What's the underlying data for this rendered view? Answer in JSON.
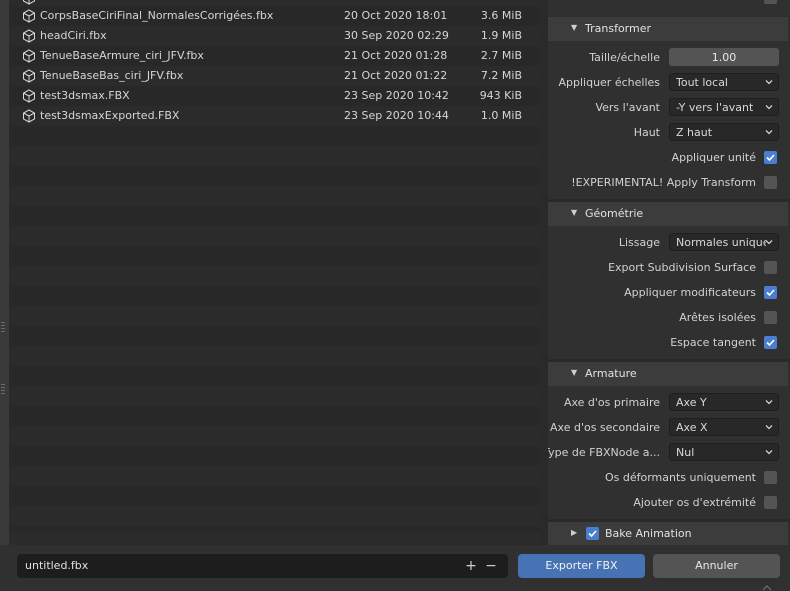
{
  "files": [
    {
      "name": "CorpsBaseCiriFinal_NormalesCorrigées.fbx",
      "date": "20 Oct 2020 18:01",
      "size": "3.6 MiB"
    },
    {
      "name": "headCiri.fbx",
      "date": "30 Sep 2020 02:29",
      "size": "1.9 MiB"
    },
    {
      "name": "TenueBaseArmure_ciri_JFV.fbx",
      "date": "21 Oct 2020 01:28",
      "size": "2.7 MiB"
    },
    {
      "name": "TenueBaseBas_ciri_JFV.fbx",
      "date": "21 Oct 2020 01:22",
      "size": "7.2 MiB"
    },
    {
      "name": "test3dsmax.FBX",
      "date": "23 Sep 2020 10:42",
      "size": "943 KiB"
    },
    {
      "name": "test3dsmaxExported.FBX",
      "date": "23 Sep 2020 10:44",
      "size": "1.0 MiB"
    }
  ],
  "transformer": {
    "title": "Transformer",
    "scale_label": "Taille/échelle",
    "scale_value": "1.00",
    "apply_scalings_label": "Appliquer échelles",
    "apply_scalings_value": "Tout local",
    "forward_label": "Vers l'avant",
    "forward_value": "-Y vers l'avant",
    "up_label": "Haut",
    "up_value": "Z haut",
    "apply_unit_label": "Appliquer unité",
    "apply_unit_checked": true,
    "apply_transform_label": "!EXPERIMENTAL! Apply Transform",
    "apply_transform_checked": false
  },
  "geometry": {
    "title": "Géométrie",
    "smoothing_label": "Lissage",
    "smoothing_value": "Normales unique...",
    "subdiv_label": "Export Subdivision Surface",
    "subdiv_checked": false,
    "modifiers_label": "Appliquer modificateurs",
    "modifiers_checked": true,
    "loose_label": "Arêtes isolées",
    "loose_checked": false,
    "tangent_label": "Espace tangent",
    "tangent_checked": true
  },
  "armature": {
    "title": "Armature",
    "primary_label": "Axe d'os primaire",
    "primary_value": "Axe Y",
    "secondary_label": "Axe d'os secondaire",
    "secondary_value": "Axe X",
    "node_type_label": "Type de FBXNode a...",
    "node_type_value": "Nul",
    "deform_only_label": "Os déformants uniquement",
    "deform_only_checked": false,
    "leaf_bones_label": "Ajouter os d'extrémité",
    "leaf_bones_checked": false
  },
  "bake": {
    "title": "Bake Animation",
    "checked": true
  },
  "bottom": {
    "filename": "untitled.fbx",
    "plus": "+",
    "minus": "−",
    "export_label": "Exporter FBX",
    "cancel_label": "Annuler"
  },
  "colors": {
    "accent": "#4772b3",
    "checkbox_on": "#4a7ecf"
  }
}
